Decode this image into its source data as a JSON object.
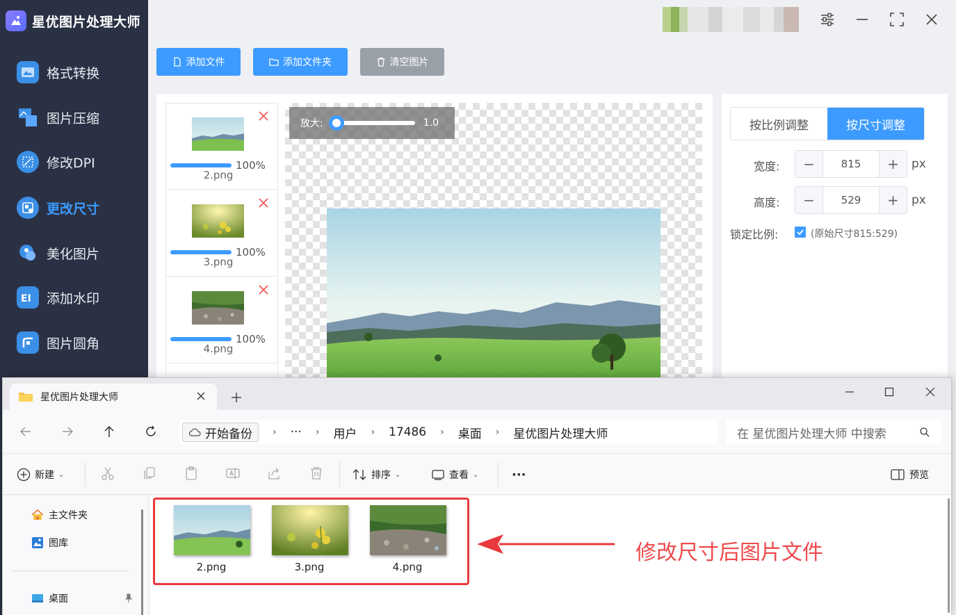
{
  "app": {
    "title": "星优图片处理大师",
    "nav": [
      {
        "label": "格式转换",
        "icon": "format-convert-icon"
      },
      {
        "label": "图片压缩",
        "icon": "image-compress-icon"
      },
      {
        "label": "修改DPI",
        "icon": "dpi-icon"
      },
      {
        "label": "更改尺寸",
        "icon": "resize-icon",
        "active": true
      },
      {
        "label": "美化图片",
        "icon": "beautify-icon"
      },
      {
        "label": "添加水印",
        "icon": "watermark-icon"
      },
      {
        "label": "图片圆角",
        "icon": "round-corner-icon"
      }
    ],
    "toolbar": {
      "add_file": "添加文件",
      "add_folder": "添加文件夹",
      "clear_images": "清空图片"
    },
    "files": [
      {
        "name": "2.png",
        "progress": "100%",
        "progress_value": 1.0
      },
      {
        "name": "3.png",
        "progress": "100%",
        "progress_value": 1.0
      },
      {
        "name": "4.png",
        "progress": "100%",
        "progress_value": 1.0
      }
    ],
    "zoom": {
      "label": "放大:",
      "value": "1.0"
    },
    "mode_tabs": {
      "ratio": "按比例调整",
      "size": "按尺寸调整",
      "active": "size"
    },
    "width": {
      "label": "宽度:",
      "value": "815",
      "unit": "px"
    },
    "height": {
      "label": "高度:",
      "value": "529",
      "unit": "px"
    },
    "lock": {
      "label": "锁定比例:",
      "checked": true,
      "original": "(原始尺寸815:529)"
    },
    "accent": "#3d9bff"
  },
  "explorer": {
    "tab_title": "星优图片处理大师",
    "breadcrumb": {
      "chip": "开始备份",
      "more": "···",
      "items": [
        "用户",
        "17486",
        "桌面",
        "星优图片处理大师"
      ]
    },
    "search_placeholder": "在 星优图片处理大师 中搜索",
    "toolbar": {
      "new": "新建",
      "sort": "排序",
      "view": "查看",
      "more": "···",
      "preview": "预览"
    },
    "nav_pane": {
      "home": "主文件夹",
      "gallery": "图库",
      "desktop": "桌面"
    },
    "files": [
      {
        "name": "2.png"
      },
      {
        "name": "3.png"
      },
      {
        "name": "4.png"
      }
    ]
  },
  "annotation": {
    "text": "修改尺寸后图片文件",
    "color": "#ee4a4c"
  }
}
